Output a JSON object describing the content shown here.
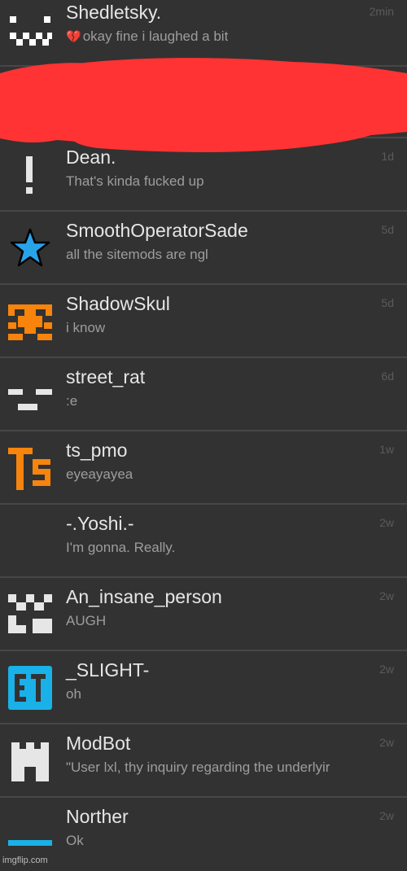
{
  "conversations": [
    {
      "name": "Shedletsky.",
      "message": "okay fine i laughed a bit",
      "time": "2min",
      "avatar_color": "#ffffff",
      "message_icon": "broken-heart"
    },
    {
      "name": "",
      "message": "",
      "time": "",
      "redacted": true
    },
    {
      "name": "Dean.",
      "message": "That's kinda fucked up",
      "time": "1d",
      "avatar_color": "#e6e6e6"
    },
    {
      "name": "SmoothOperatorSade",
      "message": "all the sitemods are ngl",
      "time": "5d",
      "avatar_color": "#29a3e8"
    },
    {
      "name": "ShadowSkul",
      "message": "i know",
      "time": "5d",
      "avatar_color": "#f7840d"
    },
    {
      "name": "street_rat",
      "message": ":e",
      "time": "6d",
      "avatar_color": "#e6e6e6"
    },
    {
      "name": "ts_pmo",
      "message": "eyeayayea",
      "time": "1w",
      "avatar_color": "#f7840d"
    },
    {
      "name": "-.Yoshi.-",
      "message": "I'm gonna. Really.",
      "time": "2w",
      "avatar_color": ""
    },
    {
      "name": "An_insane_person",
      "message": "AUGH",
      "time": "2w",
      "avatar_color": "#e6e6e6"
    },
    {
      "name": "_SLIGHT-",
      "message": "oh",
      "time": "2w",
      "avatar_color": "#29a3e8"
    },
    {
      "name": "ModBot",
      "message": "\"User lxl, thy inquiry regarding the underlyir",
      "time": "2w",
      "avatar_color": "#e6e6e6"
    },
    {
      "name": "Norther",
      "message": "Ok",
      "time": "2w",
      "avatar_color": "#1ab0e8"
    }
  ],
  "redaction_color": "#ff3333",
  "watermark": "imgflip.com"
}
